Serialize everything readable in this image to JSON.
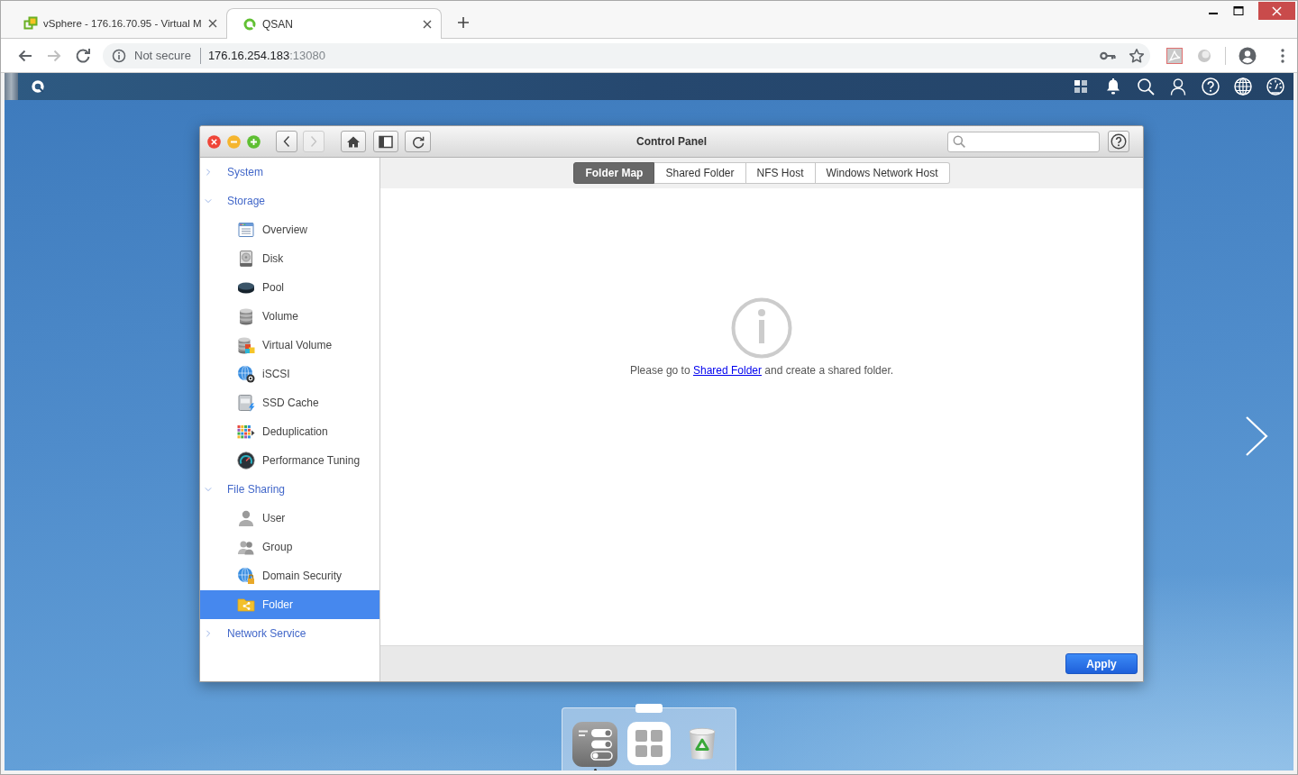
{
  "browser": {
    "tabs": [
      {
        "title": "vSphere - 176.16.70.95 - Virtual M",
        "selected": false
      },
      {
        "title": "QSAN",
        "selected": true
      }
    ],
    "nav_buttons": [
      {
        "disabled": false
      },
      {
        "disabled": true
      }
    ],
    "address": {
      "security": "Not secure",
      "host": "176.16.254.183",
      "port": ":13080"
    }
  },
  "window": {
    "title": "Control Panel",
    "nav_buttons": [
      {
        "disabled": false
      },
      {
        "disabled": true
      }
    ]
  },
  "sidebar": {
    "items": [
      {
        "label": "System",
        "expanded": false
      },
      {
        "label": "Storage",
        "expanded": true,
        "children": [
          {
            "label": "Overview",
            "selected": false
          },
          {
            "label": "Disk",
            "selected": false
          },
          {
            "label": "Pool",
            "selected": false
          },
          {
            "label": "Volume",
            "selected": false
          },
          {
            "label": "Virtual Volume",
            "selected": false
          },
          {
            "label": "iSCSI",
            "selected": false
          },
          {
            "label": "SSD Cache",
            "selected": false
          },
          {
            "label": "Deduplication",
            "selected": false
          },
          {
            "label": "Performance Tuning",
            "selected": false
          }
        ]
      },
      {
        "label": "File Sharing",
        "expanded": true,
        "children": [
          {
            "label": "User",
            "selected": false
          },
          {
            "label": "Group",
            "selected": false
          },
          {
            "label": "Domain Security",
            "selected": false
          },
          {
            "label": "Folder",
            "selected": true
          }
        ]
      },
      {
        "label": "Network Service",
        "expanded": false
      }
    ]
  },
  "tabs": [
    {
      "label": "Folder Map",
      "selected": true
    },
    {
      "label": "Shared Folder",
      "selected": false
    },
    {
      "label": "NFS Host",
      "selected": false
    },
    {
      "label": "Windows Network Host",
      "selected": false
    }
  ],
  "message": {
    "before": "Please go to",
    "link": "Shared Folder",
    "after": "and create a shared folder."
  },
  "footer": {
    "buttons": [
      "Apply"
    ]
  },
  "dock": {
    "items": [
      {
        "running": true
      },
      {
        "running": false
      },
      {
        "running": false
      }
    ]
  }
}
